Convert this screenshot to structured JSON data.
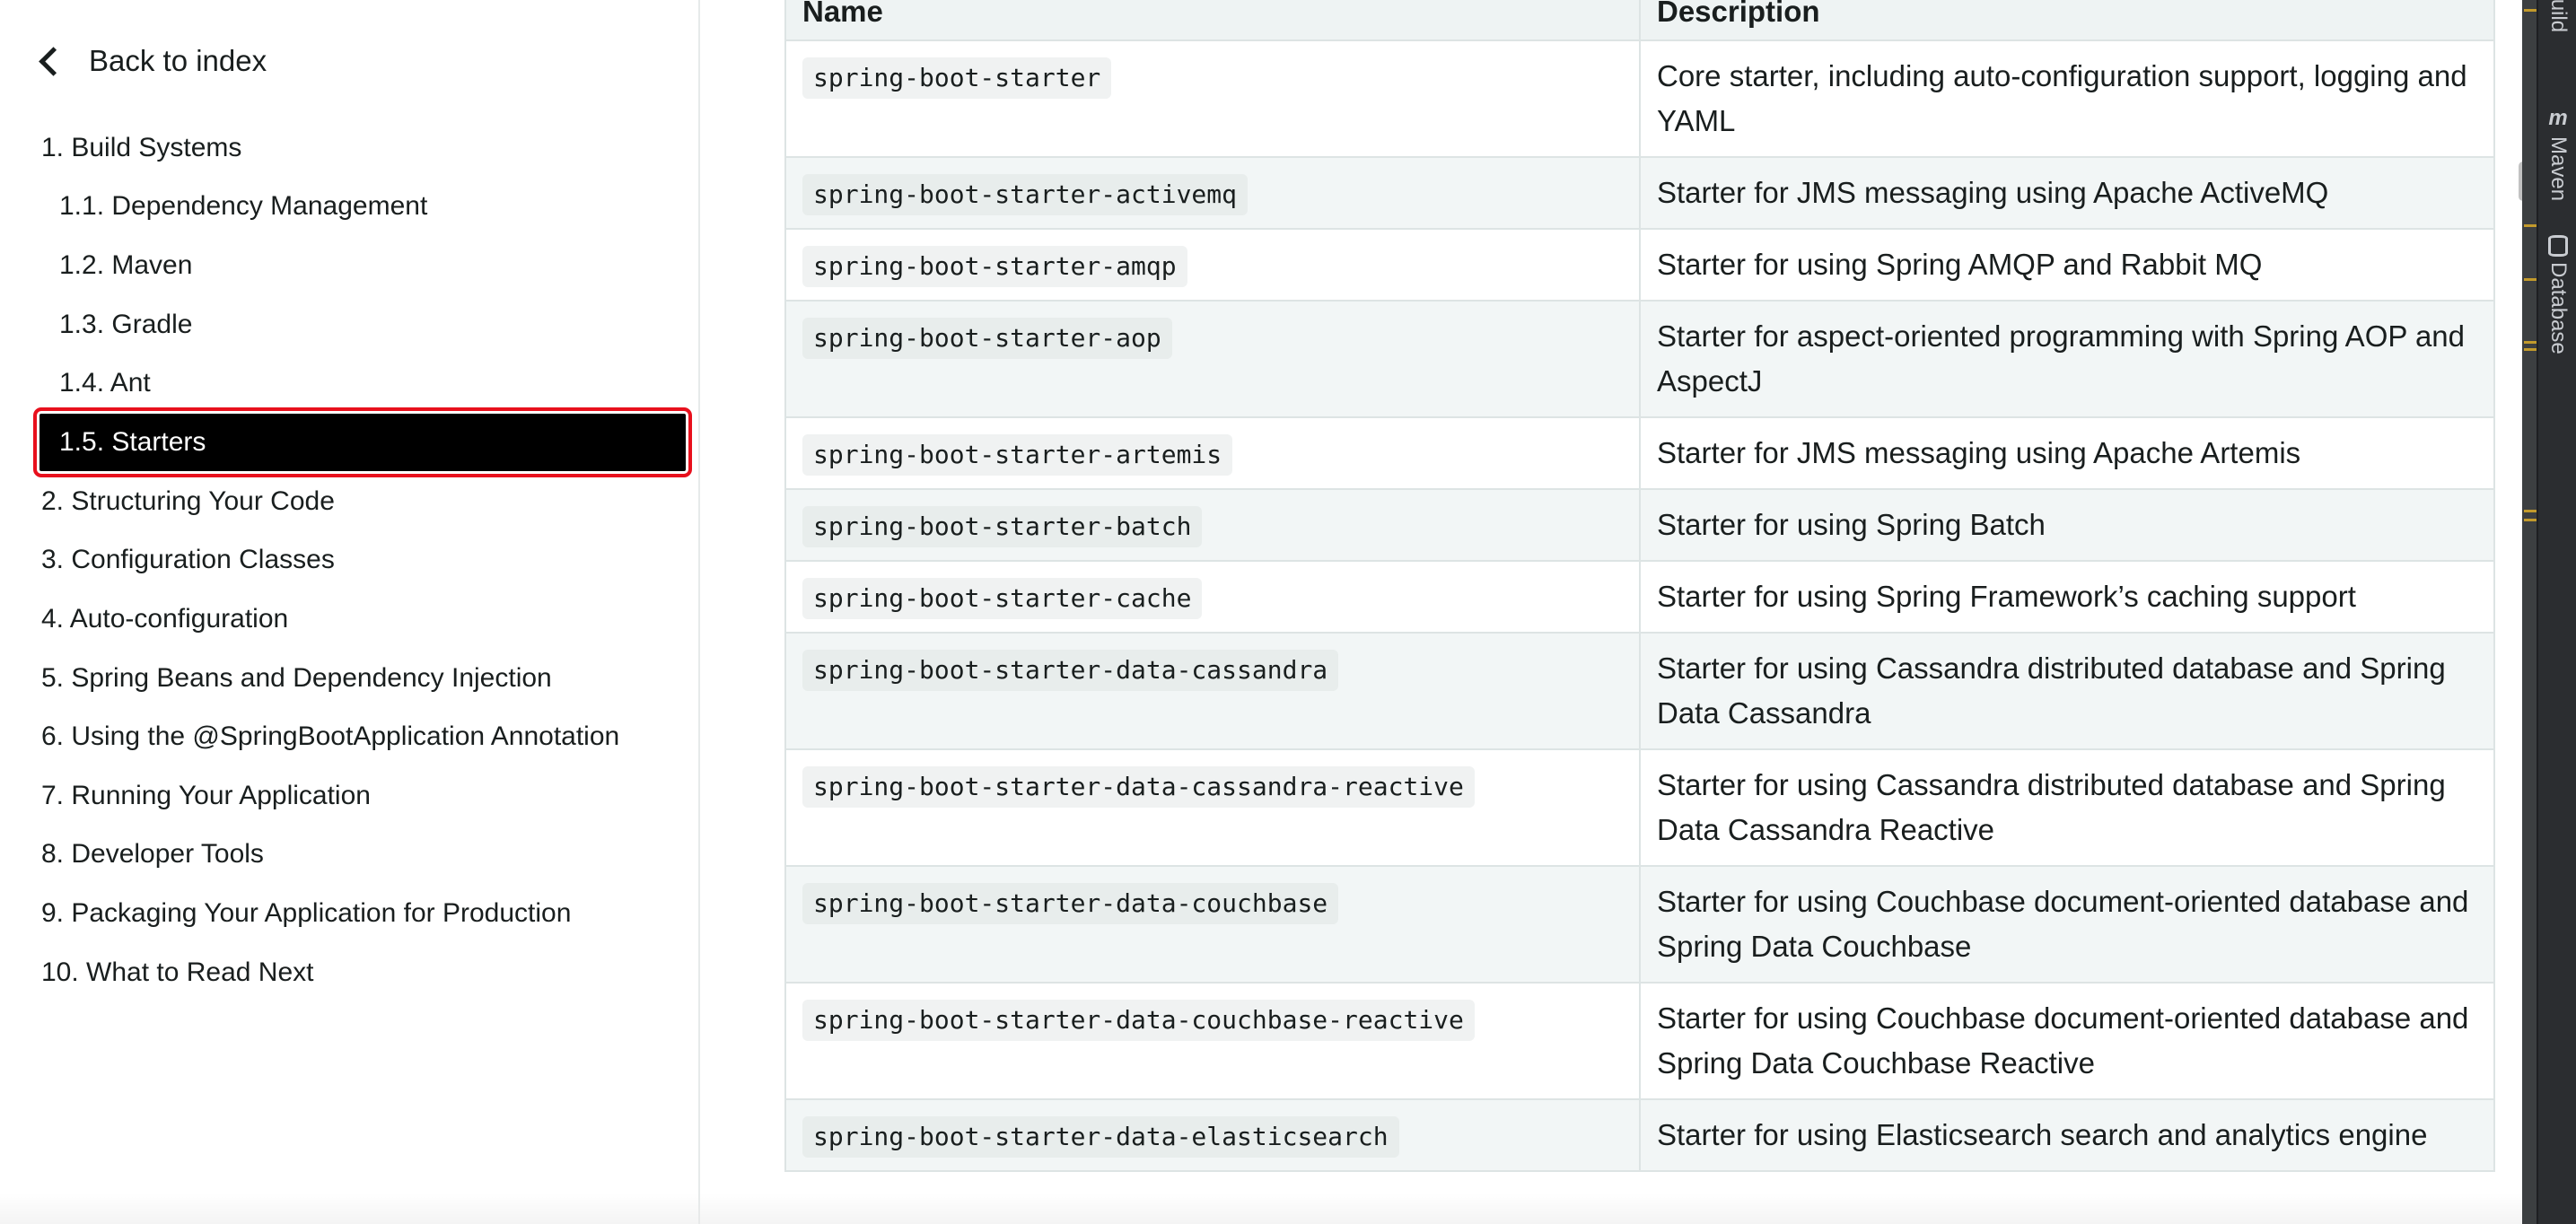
{
  "sidebar": {
    "back_label": "Back to index",
    "toc": [
      {
        "label": "1. Build Systems",
        "level": 1,
        "active": false
      },
      {
        "label": "1.1. Dependency Management",
        "level": 2,
        "active": false
      },
      {
        "label": "1.2. Maven",
        "level": 2,
        "active": false
      },
      {
        "label": "1.3. Gradle",
        "level": 2,
        "active": false
      },
      {
        "label": "1.4. Ant",
        "level": 2,
        "active": false
      },
      {
        "label": "1.5. Starters",
        "level": 2,
        "active": true
      },
      {
        "label": "2. Structuring Your Code",
        "level": 1,
        "active": false
      },
      {
        "label": "3. Configuration Classes",
        "level": 1,
        "active": false
      },
      {
        "label": "4. Auto-configuration",
        "level": 1,
        "active": false
      },
      {
        "label": "5. Spring Beans and Dependency Injection",
        "level": 1,
        "active": false
      },
      {
        "label": "6. Using the @SpringBootApplication Annotation",
        "level": 1,
        "active": false
      },
      {
        "label": "7. Running Your Application",
        "level": 1,
        "active": false
      },
      {
        "label": "8. Developer Tools",
        "level": 1,
        "active": false
      },
      {
        "label": "9. Packaging Your Application for Production",
        "level": 1,
        "active": false
      },
      {
        "label": "10. What to Read Next",
        "level": 1,
        "active": false
      }
    ]
  },
  "table": {
    "headers": [
      "Name",
      "Description"
    ],
    "rows": [
      {
        "name": "spring-boot-starter",
        "description": "Core starter, including auto-configuration support, logging and YAML"
      },
      {
        "name": "spring-boot-starter-activemq",
        "description": "Starter for JMS messaging using Apache ActiveMQ"
      },
      {
        "name": "spring-boot-starter-amqp",
        "description": "Starter for using Spring AMQP and Rabbit MQ"
      },
      {
        "name": "spring-boot-starter-aop",
        "description": "Starter for aspect-oriented programming with Spring AOP and AspectJ"
      },
      {
        "name": "spring-boot-starter-artemis",
        "description": "Starter for JMS messaging using Apache Artemis"
      },
      {
        "name": "spring-boot-starter-batch",
        "description": "Starter for using Spring Batch"
      },
      {
        "name": "spring-boot-starter-cache",
        "description": "Starter for using Spring Framework’s caching support"
      },
      {
        "name": "spring-boot-starter-data-cassandra",
        "description": "Starter for using Cassandra distributed database and Spring Data Cassandra"
      },
      {
        "name": "spring-boot-starter-data-cassandra-reactive",
        "description": "Starter for using Cassandra distributed database and Spring Data Cassandra Reactive"
      },
      {
        "name": "spring-boot-starter-data-couchbase",
        "description": "Starter for using Couchbase document-oriented database and Spring Data Couchbase"
      },
      {
        "name": "spring-boot-starter-data-couchbase-reactive",
        "description": "Starter for using Couchbase document-oriented database and Spring Data Couchbase Reactive"
      },
      {
        "name": "spring-boot-starter-data-elasticsearch",
        "description": "Starter for using Elasticsearch search and analytics engine"
      }
    ]
  },
  "ide": {
    "tabs": [
      {
        "label": "Ant Build",
        "icon": "ant-build-icon"
      },
      {
        "label": "Maven",
        "icon": "maven-icon"
      },
      {
        "label": "Database",
        "icon": "database-icon"
      }
    ],
    "maven_glyph": "m"
  },
  "colors": {
    "active_bg": "#000000",
    "active_outline": "#e8101d",
    "table_stripe": "#f2f6f6",
    "ide_bg": "#2b2d30"
  }
}
